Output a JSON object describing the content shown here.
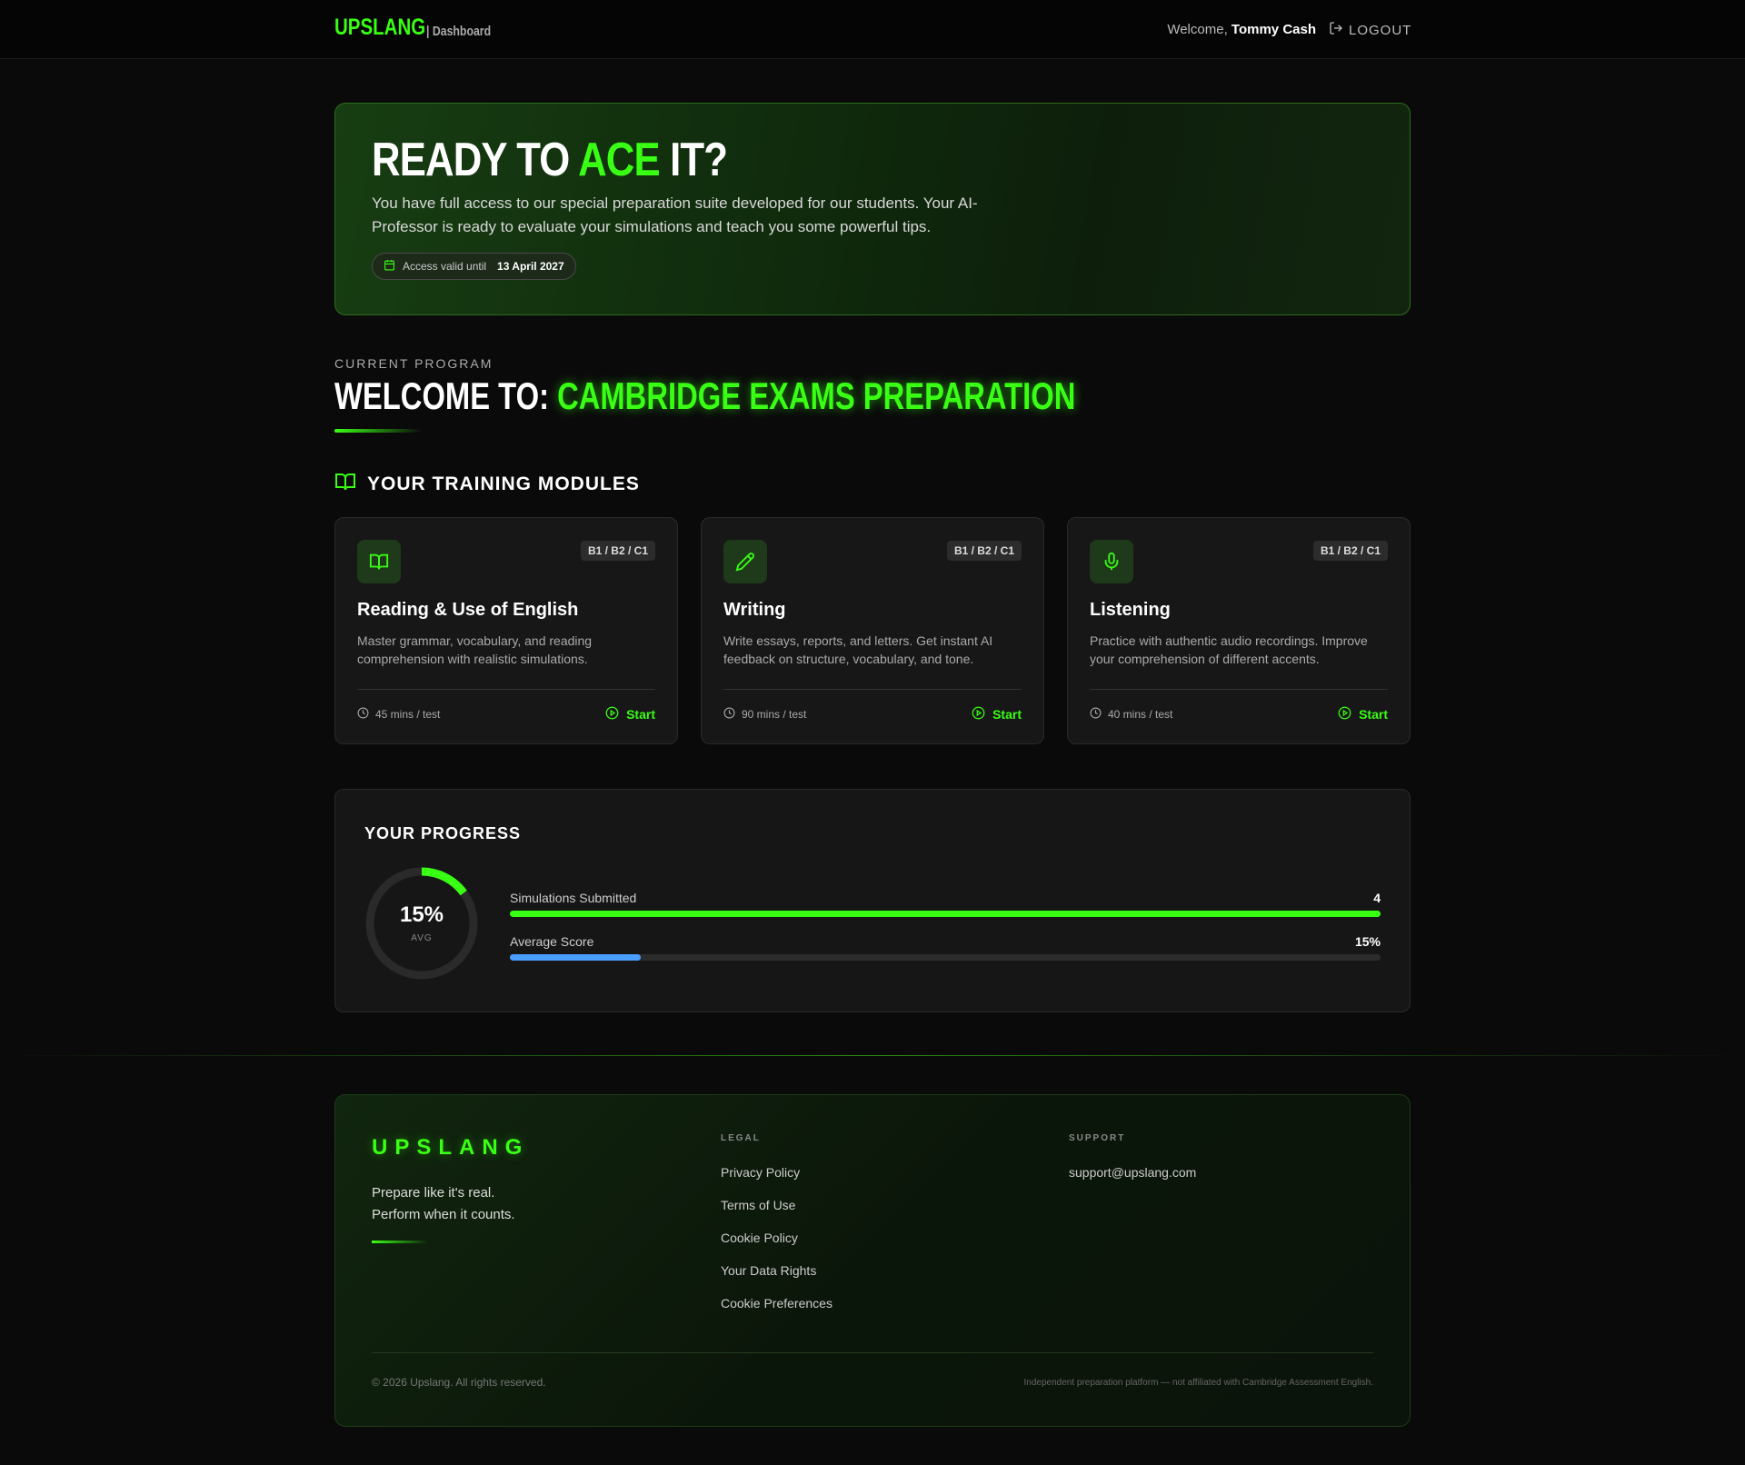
{
  "header": {
    "logo": "UPSLANG",
    "section": "| Dashboard",
    "welcome_prefix": "Welcome,",
    "user_name": "Tommy Cash",
    "logout": "LOGOUT"
  },
  "hero": {
    "title_a": "READY TO ",
    "title_highlight": "ACE",
    "title_b": " IT?",
    "description": "You have full access to our special preparation suite developed for our students. Your AI-Professor is ready to evaluate your simulations and teach you some powerful tips.",
    "access_label": "Access valid until",
    "access_date": "13 April 2027"
  },
  "program": {
    "label": "CURRENT PROGRAM",
    "prefix": "WELCOME TO: ",
    "name": "CAMBRIDGE EXAMS PREPARATION"
  },
  "modules": {
    "heading": "YOUR TRAINING MODULES",
    "items": [
      {
        "title": "Reading & Use of English",
        "level": "B1 / B2 / C1",
        "description": "Master grammar, vocabulary, and reading comprehension with realistic simulations.",
        "time": "45 mins / test",
        "action": "Start",
        "icon": "book-icon"
      },
      {
        "title": "Writing",
        "level": "B1 / B2 / C1",
        "description": "Write essays, reports, and letters. Get instant AI feedback on structure, vocabulary, and tone.",
        "time": "90 mins / test",
        "action": "Start",
        "icon": "pencil-icon"
      },
      {
        "title": "Listening",
        "level": "B1 / B2 / C1",
        "description": "Practice with authentic audio recordings. Improve your comprehension of different accents.",
        "time": "40 mins / test",
        "action": "Start",
        "icon": "microphone-icon"
      }
    ]
  },
  "progress": {
    "heading": "YOUR PROGRESS",
    "ring_value": "15%",
    "ring_label": "AVG",
    "ring_fraction": 0.15,
    "stats": [
      {
        "label": "Simulations Submitted",
        "value": "4",
        "fraction": 1.0,
        "color": "#39ff14"
      },
      {
        "label": "Average Score",
        "value": "15%",
        "fraction": 0.15,
        "color": "#4a9eff"
      }
    ]
  },
  "footer": {
    "logo": "UPSLANG",
    "tagline_1": "Prepare like it's real.",
    "tagline_2": "Perform when it counts.",
    "legal_heading": "LEGAL",
    "legal_links": [
      "Privacy Policy",
      "Terms of Use",
      "Cookie Policy",
      "Your Data Rights",
      "Cookie Preferences"
    ],
    "support_heading": "SUPPORT",
    "support_email": "support@upslang.com",
    "copyright": "© 2026 Upslang. All rights reserved.",
    "disclaimer": "Independent preparation platform — not affiliated with Cambridge Assessment English."
  },
  "colors": {
    "accent": "#39ff14",
    "score": "#4a9eff"
  }
}
